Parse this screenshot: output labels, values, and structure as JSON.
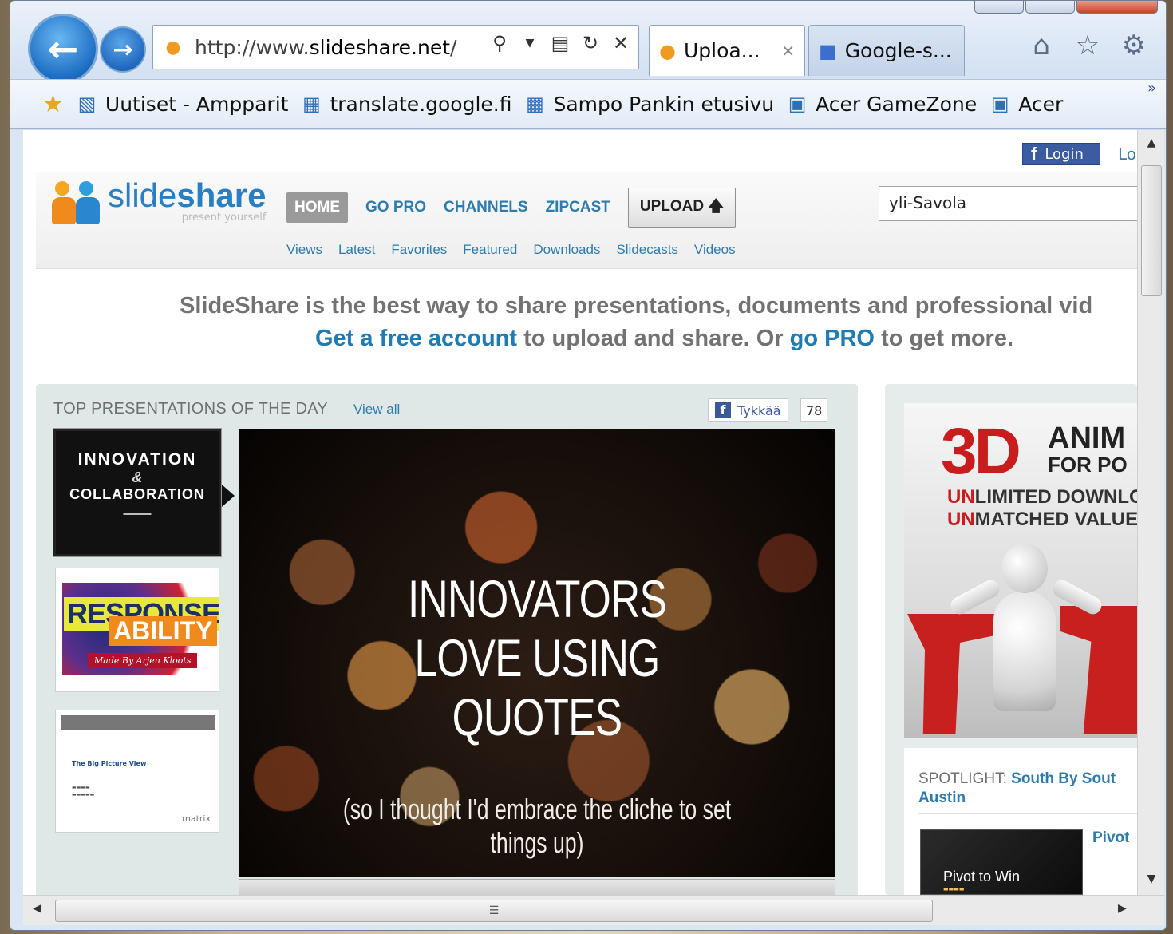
{
  "browser": {
    "address_url_prefix": "http://www.",
    "address_url_domain": "slideshare.net",
    "address_url_suffix": "/",
    "tabs": [
      {
        "label": "Uploa...",
        "active": true
      },
      {
        "label": "Google-s...",
        "active": false
      }
    ],
    "favorites": [
      {
        "label": "Uutiset - Ampparit",
        "icon": "ie-page-icon"
      },
      {
        "label": "translate.google.fi",
        "icon": "translate-icon"
      },
      {
        "label": "Sampo Pankin etusivu",
        "icon": "bank-icon"
      },
      {
        "label": "Acer GameZone",
        "icon": "shortcut-icon"
      },
      {
        "label": "Acer",
        "icon": "shortcut-icon"
      }
    ],
    "more_chevron": "»"
  },
  "page": {
    "fb_login": "Login",
    "login_cut": "Lo",
    "logo": {
      "word_light": "slide",
      "word_bold": "share",
      "tagline": "present yourself"
    },
    "nav": {
      "home": "HOME",
      "go_pro": "GO PRO",
      "channels": "CHANNELS",
      "zipcast": "ZIPCAST",
      "upload": "UPLOAD"
    },
    "search_value": "yli-Savola",
    "subnav": [
      "Views",
      "Latest",
      "Favorites",
      "Featured",
      "Downloads",
      "Slidecasts",
      "Videos"
    ],
    "tagline_1": "SlideShare is the best way to share presentations, documents and professional vid",
    "tagline_2_link1": "Get a free account",
    "tagline_2_mid": " to upload and share. Or ",
    "tagline_2_link2": "go PRO",
    "tagline_2_end": " to get more.",
    "top_presentations": {
      "title": "TOP PRESENTATIONS OF THE DAY",
      "view_all": "View all",
      "like_label": "Tykkää",
      "like_count": "78"
    },
    "thumbs": {
      "t1_line1": "INNOVATION",
      "t1_amp": "&",
      "t1_line2": "COLLABORATION",
      "t2_word1": "RESPONSE",
      "t2_word2": "ABILITY",
      "t2_byline": "Made By Arjen Kloots",
      "t3_title": "The Big Picture View",
      "t3_brand": "matrix"
    },
    "main_slide": {
      "title_line1": "INNOVATORS",
      "title_line2": "LOVE USING",
      "title_line3": "QUOTES",
      "subtitle": "(so I thought I'd embrace the cliche to set things up)"
    },
    "ad": {
      "big": "3D",
      "anim": "ANIM",
      "for_p": "FOR PO",
      "line1_red": "UN",
      "line1_rest": "LIMITED DOWNLO",
      "line2_red": "UN",
      "line2_rest": "MATCHED VALUE"
    },
    "spotlight": {
      "label": "SPOTLIGHT:",
      "link": "South By Sout",
      "city": "Austin",
      "thumb_title": "Pivot to Win",
      "side_link": "Pivot"
    }
  },
  "colors": {
    "link_blue": "#2e7cae",
    "brand_orange": "#f08a1c",
    "ad_red": "#c91d1d"
  }
}
